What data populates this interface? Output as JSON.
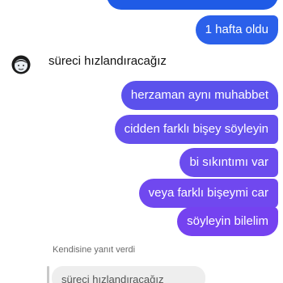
{
  "thread": {
    "sent_top": "1 hafta oldu",
    "received": "süreci hızlandıracağız",
    "sent_messages": [
      "herzaman aynı muhabbet",
      "cidden farklı bişey söyleyin",
      "bi sıkıntımı var",
      "veya farklı bişeymi car",
      "söyleyin bilelim"
    ],
    "reply": {
      "label": "Kendisine yanıt verdi",
      "quoted_text": "süreci hızlandıracağız"
    }
  },
  "colors": {
    "sent_gradient_top": "#2b60ea",
    "sent_gradient_bottom": "#7040ef",
    "received_text": "#111111",
    "reply_bg": "#eeeeee"
  },
  "icons": {
    "avatar": "face-avatar-icon"
  }
}
